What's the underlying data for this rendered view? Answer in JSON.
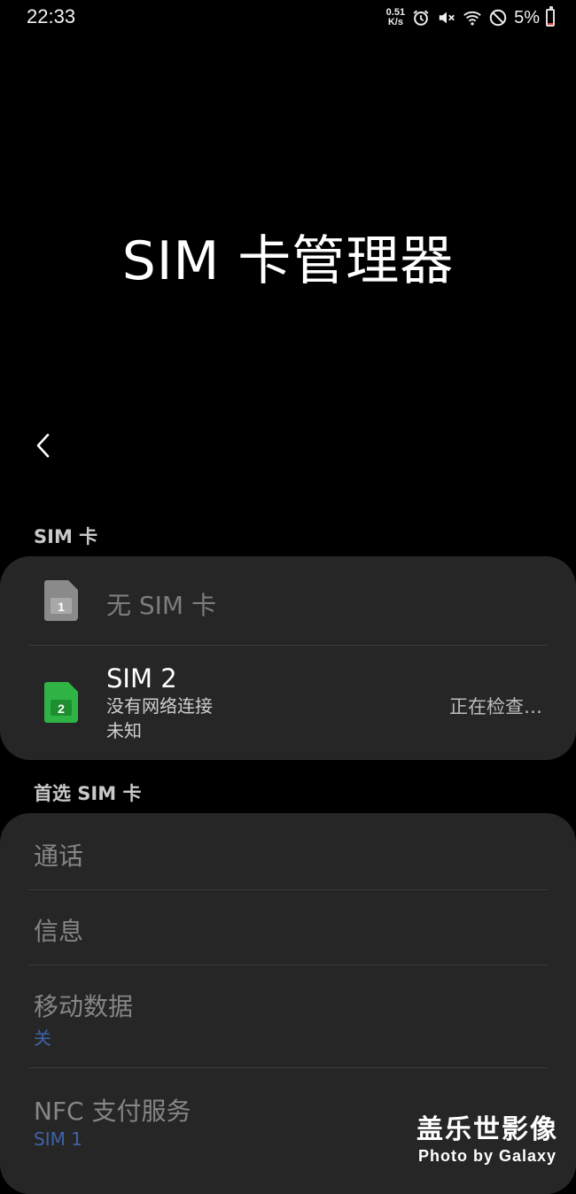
{
  "status_bar": {
    "time": "22:33",
    "net_speed_value": "0.51",
    "net_speed_unit": "K/s",
    "icons": [
      "alarm-icon",
      "mute-icon",
      "wifi-icon",
      "dnd-icon"
    ],
    "battery_percent": "5%",
    "battery_level": 0.05,
    "battery_color": "#e53935"
  },
  "page": {
    "title": "SIM 卡管理器",
    "back_icon": "chevron-left-icon"
  },
  "sim_section": {
    "header": "SIM 卡",
    "sim1": {
      "icon": "sim-card-icon",
      "slot": "1",
      "label": "无 SIM 卡"
    },
    "sim2": {
      "icon": "sim-card-icon",
      "slot": "2",
      "name": "SIM 2",
      "network": "没有网络连接",
      "carrier": "未知",
      "status": "正在检查…",
      "color": "#2fb344"
    }
  },
  "preferred_section": {
    "header": "首选 SIM 卡",
    "items": [
      {
        "label": "通话",
        "value": ""
      },
      {
        "label": "信息",
        "value": ""
      },
      {
        "label": "移动数据",
        "value": "关"
      },
      {
        "label": "NFC 支付服务",
        "value": "SIM 1"
      }
    ],
    "value_color": "#3f63a8"
  },
  "watermark": {
    "line1": "盖乐世影像",
    "line2": "Photo by Galaxy"
  }
}
